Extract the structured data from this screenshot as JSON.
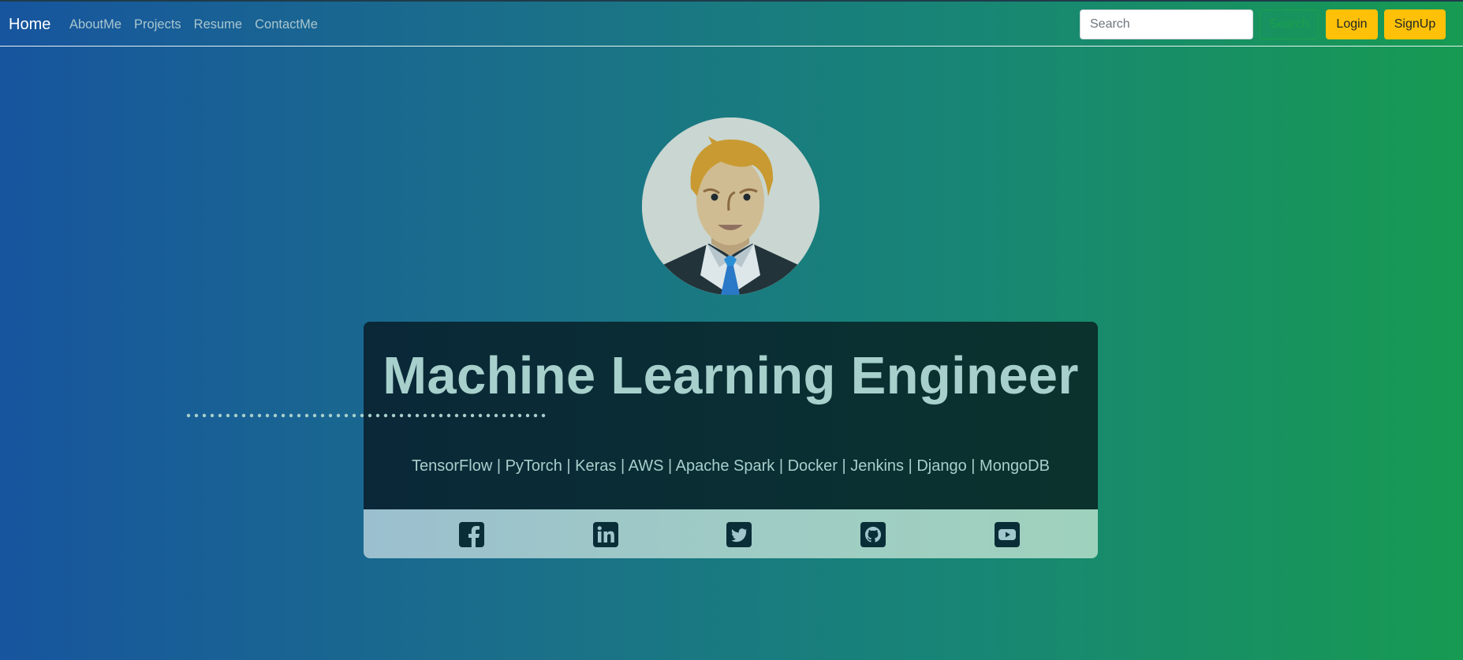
{
  "nav": {
    "brand": "Home",
    "links": [
      "AboutMe",
      "Projects",
      "Resume",
      "ContactMe"
    ],
    "search_placeholder": "Search",
    "search_button": "Search",
    "login_button": "Login",
    "signup_button": "SignUp"
  },
  "hero": {
    "title": "Machine Learning Engineer",
    "skills": "TensorFlow | PyTorch | Keras | AWS | Apache Spark | Docker | Jenkins | Django | MongoDB"
  },
  "social": [
    "facebook-icon",
    "linkedin-icon",
    "twitter-icon",
    "github-icon",
    "youtube-icon"
  ],
  "colors": {
    "accent_yellow": "#ffc107",
    "search_green": "#1aa04b",
    "headline": "#a7d0cc",
    "card_dark": "#0a2838"
  }
}
